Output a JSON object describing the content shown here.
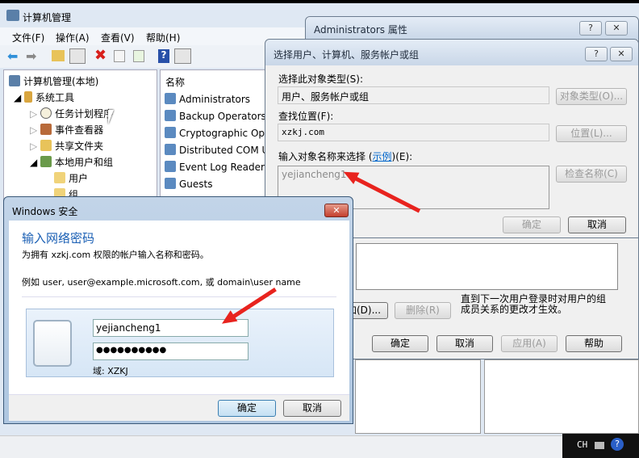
{
  "main": {
    "title": "计算机管理",
    "menu": [
      "文件(F)",
      "操作(A)",
      "查看(V)",
      "帮助(H)"
    ],
    "tree": [
      "计算机管理(本地)",
      "系统工具",
      "任务计划程序",
      "事件查看器",
      "共享文件夹",
      "本地用户和组",
      "用户",
      "组"
    ],
    "list_header": "名称",
    "list": [
      "Administrators",
      "Backup Operators",
      "Cryptographic Op",
      "Distributed COM U",
      "Event Log Reader",
      "Guests"
    ]
  },
  "props": {
    "title": "Administrators 属性",
    "add": "添加(D)...",
    "remove": "删除(R)",
    "note": "直到下一次用户登录时对用户的组成员关系的更改才生效。",
    "ok": "确定",
    "cancel": "取消",
    "apply": "应用(A)",
    "help": "帮助"
  },
  "select": {
    "title": "选择用户、计算机、服务帐户或组",
    "type_label": "选择此对象类型(S):",
    "type_value": "用户、服务帐户或组",
    "type_btn": "对象类型(O)...",
    "loc_label": "查找位置(F):",
    "loc_value": "xzkj.com",
    "loc_btn": "位置(L)...",
    "name_label_pre": "输入对象名称来选择 (",
    "name_link": "示例",
    "name_label_post": ")(E):",
    "name_value": "yejiancheng1",
    "check_btn": "检查名称(C)",
    "ok": "确定",
    "cancel": "取消"
  },
  "security": {
    "title": "Windows 安全",
    "heading": "输入网络密码",
    "desc": "为拥有 xzkj.com 权限的帐户输入名称和密码。",
    "example": "例如 user, user@example.microsoft.com, 或 domain\\user name",
    "username": "yejiancheng1",
    "password": "●●●●●●●●●●",
    "domain": "域: XZKJ",
    "ok": "确定",
    "cancel": "取消"
  },
  "taskbar": {
    "lang": "CH"
  },
  "colors": {
    "heading": "#1a5fb4",
    "arrow": "#e8231e",
    "link": "#0066cc"
  }
}
